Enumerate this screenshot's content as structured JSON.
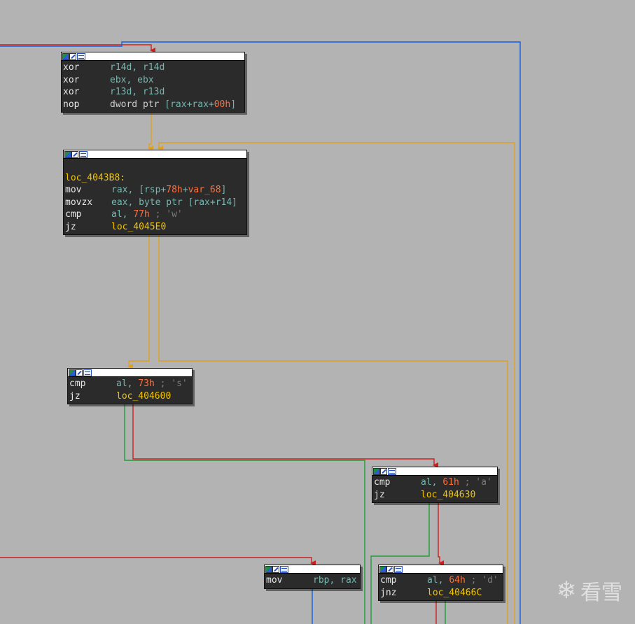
{
  "nodes": [
    {
      "id": "block-entry",
      "lines": [
        {
          "mnemonic": "xor",
          "operands": [
            {
              "t": "r14d, r14d",
              "c": "reg"
            }
          ]
        },
        {
          "mnemonic": "xor",
          "operands": [
            {
              "t": "ebx, ebx",
              "c": "reg"
            }
          ]
        },
        {
          "mnemonic": "xor",
          "operands": [
            {
              "t": "r13d, r13d",
              "c": "reg"
            }
          ]
        },
        {
          "mnemonic": "nop",
          "operands": [
            {
              "t": "dword ptr ",
              "c": "plain"
            },
            {
              "t": "[rax+rax+",
              "c": "reg"
            },
            {
              "t": "00h",
              "c": "num"
            },
            {
              "t": "]",
              "c": "reg"
            }
          ]
        }
      ]
    },
    {
      "id": "block-loc_4043B8",
      "lines": [
        {
          "mnemonic": "",
          "operands": []
        },
        {
          "label": "loc_4043B8:"
        },
        {
          "mnemonic": "mov",
          "operands": [
            {
              "t": "rax, [rsp+",
              "c": "reg"
            },
            {
              "t": "78h",
              "c": "num"
            },
            {
              "t": "+",
              "c": "reg"
            },
            {
              "t": "var_68",
              "c": "num"
            },
            {
              "t": "]",
              "c": "reg"
            }
          ]
        },
        {
          "mnemonic": "movzx",
          "operands": [
            {
              "t": "eax, byte ptr [rax+r14]",
              "c": "reg"
            }
          ]
        },
        {
          "mnemonic": "cmp",
          "operands": [
            {
              "t": "al, ",
              "c": "reg"
            },
            {
              "t": "77h",
              "c": "num"
            },
            {
              "t": " ; 'w'",
              "c": "cmt"
            }
          ]
        },
        {
          "mnemonic": "jz",
          "operands": [
            {
              "t": "loc_4045E0",
              "c": "lbl"
            }
          ]
        }
      ]
    },
    {
      "id": "block-cmp-s",
      "lines": [
        {
          "mnemonic": "cmp",
          "operands": [
            {
              "t": "al, ",
              "c": "reg"
            },
            {
              "t": "73h",
              "c": "num"
            },
            {
              "t": " ; 's'",
              "c": "cmt"
            }
          ]
        },
        {
          "mnemonic": "jz",
          "operands": [
            {
              "t": "loc_404600",
              "c": "lbl"
            }
          ]
        }
      ]
    },
    {
      "id": "block-cmp-a",
      "lines": [
        {
          "mnemonic": "cmp",
          "operands": [
            {
              "t": "al, ",
              "c": "reg"
            },
            {
              "t": "61h",
              "c": "num"
            },
            {
              "t": " ; 'a'",
              "c": "cmt"
            }
          ]
        },
        {
          "mnemonic": "jz",
          "operands": [
            {
              "t": "loc_404630",
              "c": "lbl"
            }
          ]
        }
      ]
    },
    {
      "id": "block-mov-rbp",
      "lines": [
        {
          "mnemonic": "mov",
          "operands": [
            {
              "t": "rbp, rax",
              "c": "reg"
            }
          ]
        }
      ]
    },
    {
      "id": "block-cmp-d",
      "lines": [
        {
          "mnemonic": "cmp",
          "operands": [
            {
              "t": "al, ",
              "c": "reg"
            },
            {
              "t": "64h",
              "c": "num"
            },
            {
              "t": " ; 'd'",
              "c": "cmt"
            }
          ]
        },
        {
          "mnemonic": "jnz",
          "operands": [
            {
              "t": "loc_40466C",
              "c": "lbl"
            }
          ]
        }
      ]
    }
  ],
  "colors": {
    "background": "#b3b3b3",
    "edge_true": "#1f9e3a",
    "edge_false": "#cc2020",
    "edge_unconditional": "#1060e0",
    "edge_loop": "#e0a020"
  },
  "header_icons": [
    "graph-overview-icon",
    "edit-icon",
    "comment-icon"
  ],
  "watermark": {
    "icon": "snowflake-icon",
    "text": "看雪"
  }
}
